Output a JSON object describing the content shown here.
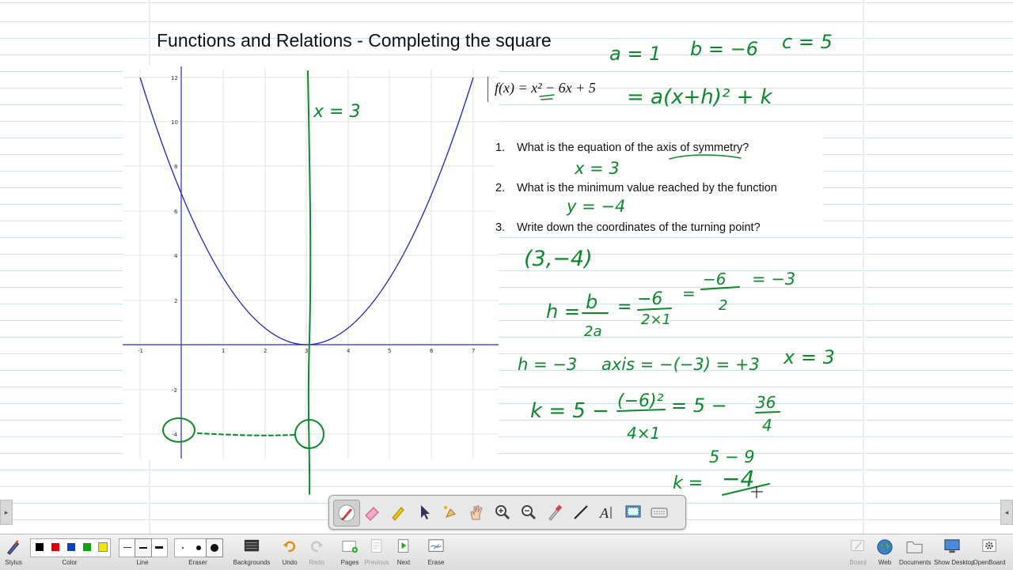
{
  "board": {
    "title": "Functions and Relations - Completing the square",
    "function_label": "f(x) = x² − 6x + 5",
    "questions": [
      {
        "num": "1.",
        "text": "What is the equation of the axis of symmetry?"
      },
      {
        "num": "2.",
        "text": "What is the minimum value reached by the function"
      },
      {
        "num": "3.",
        "text": "Write down the coordinates of the turning point?"
      }
    ],
    "graph": {
      "x_ticks": [
        "-1",
        "1",
        "2",
        "3",
        "4",
        "5",
        "6",
        "7"
      ],
      "y_ticks": [
        "12",
        "10",
        "8",
        "6",
        "4",
        "2",
        "-2",
        "-4"
      ]
    },
    "handwriting": {
      "coeffs": [
        "a = 1",
        "b = −6",
        "c = 5"
      ],
      "vertex_form": "= a(x+h)² + k",
      "axis_note": "x = 3",
      "answer1": "x = 3",
      "answer2": "y = −4",
      "answer3": "(3,−4)",
      "h_calc": [
        "h =",
        "b",
        "2a",
        "=",
        "−6",
        "2×1",
        "=",
        "−6",
        "2",
        "= −3"
      ],
      "h_line": [
        "h = −3",
        "axis = −(−3) = +3",
        "x = 3"
      ],
      "k_calc": [
        "k = 5 −",
        "(−6)²",
        "4×1",
        "= 5 −",
        "36",
        "4"
      ],
      "k_sub": "5 − 9",
      "k_result": [
        "k =",
        "−4"
      ]
    },
    "colors": {
      "ink_green": "#0b8a2a",
      "curve_blue": "#1f1fc8",
      "axis_blue": "#2a2ad0"
    }
  },
  "palette": {
    "tools": [
      "stylus-pen-icon",
      "highlighter-eraser-icon",
      "marker-icon",
      "pointer-icon",
      "laser-pointer-icon",
      "hand-icon",
      "zoom-in-icon",
      "zoom-out-icon",
      "pipette-icon",
      "line-icon",
      "text-icon",
      "capture-icon",
      "keyboard-icon"
    ],
    "text_tool_label": "A"
  },
  "toolbar": {
    "stylus": "Stylus",
    "color": "Color",
    "line": "Line",
    "eraser": "Eraser",
    "backgrounds": "Backgrounds",
    "undo": "Undo",
    "redo": "Redo",
    "pages": "Pages",
    "previous": "Previous",
    "next": "Next",
    "erase": "Erase",
    "board": "Board",
    "web": "Web",
    "documents": "Documents",
    "show_desktop": "Show Desktop",
    "openboard": "OpenBoard",
    "colors": [
      "#000000",
      "#e00000",
      "#1040c0",
      "#10a010",
      "#f5e400"
    ]
  }
}
